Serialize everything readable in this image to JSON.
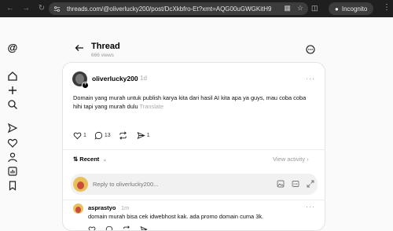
{
  "browser": {
    "url": "threads.com/@oliverlucky200/post/DcXkbfro-Et?xmt=AQG00uGWGKitH919J...",
    "mode_label": "Incognito"
  },
  "thread_header": {
    "title": "Thread",
    "views": "666 views"
  },
  "post": {
    "username": "oliverlucky200",
    "time": "1d",
    "text": "Domain yang murah untuk publish karya kita dari hasil AI kita apa ya guys, mau coba coba hihi tapi yang murah dulu",
    "translate_label": "Translate",
    "likes": "1",
    "replies": "13",
    "shares": "1"
  },
  "sort": {
    "label": "Recent",
    "view_activity": "View activity"
  },
  "reply_box": {
    "placeholder": "Reply to oliverlucky200..."
  },
  "comment": {
    "username": "asprastyo",
    "time": "1m",
    "text": "domain murah bisa cek idwebhost kak. ada promo domain cuma 3k."
  },
  "colors": {
    "chrome_bg": "#1f1f1f",
    "page_bg": "#fafafa",
    "card_bg": "#ffffff"
  }
}
